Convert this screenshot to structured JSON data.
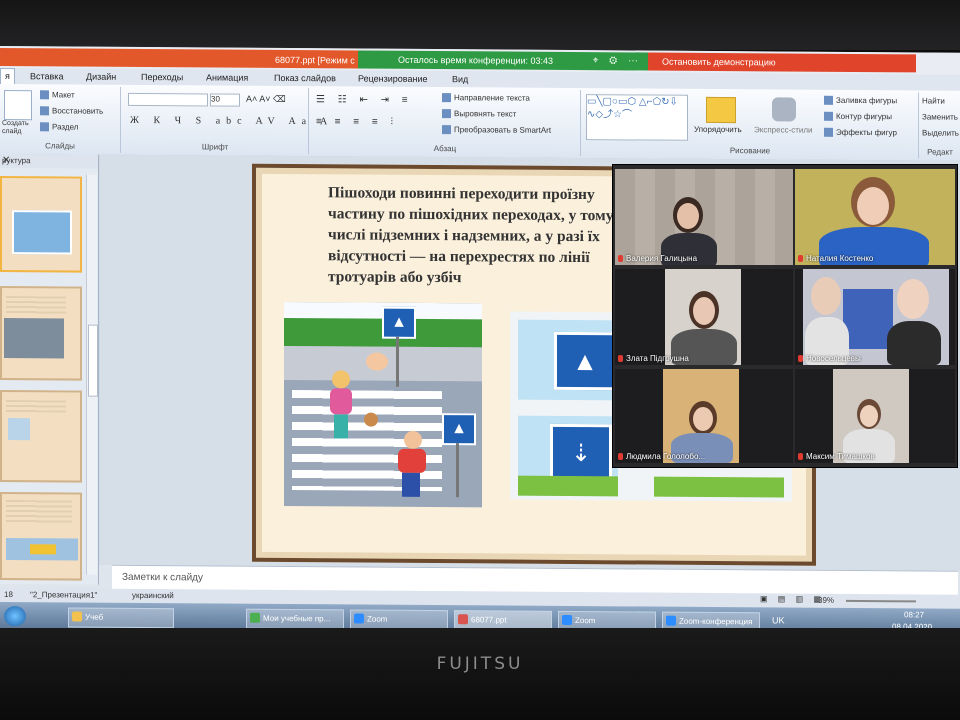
{
  "window": {
    "title": "68077.ppt [Режим с",
    "conference_timer": "Осталось время конференции: 03:43",
    "stop_demo": "Остановить демонстрацию"
  },
  "tabs": [
    "Вставка",
    "Дизайн",
    "Переходы",
    "Анимация",
    "Показ слайдов",
    "Рецензирование",
    "Вид"
  ],
  "ribbon": {
    "slides_group": {
      "create": "Создать слайд",
      "layout": "Макет",
      "reset": "Восстановить",
      "section": "Раздел",
      "label": "Слайды"
    },
    "font_group": {
      "size": "30",
      "label": "Шрифт"
    },
    "paragraph_group": {
      "text_direction": "Направление текста",
      "align_text": "Выровнять текст",
      "smartart": "Преобразовать в SmartArt",
      "label": "Абзац"
    },
    "drawing_group": {
      "arrange": "Упорядочить",
      "quick_styles": "Экспресс-стили",
      "fill": "Заливка фигуры",
      "outline": "Контур фигуры",
      "effects": "Эффекты фигур",
      "label": "Рисование"
    },
    "editing_group": {
      "find": "Найти",
      "replace": "Заменить",
      "select": "Выделить",
      "label": "Редакт"
    }
  },
  "panel": {
    "title": "руктура"
  },
  "slide": {
    "text": "Пішоходи повинні переходити проїзну частину по пішохідних переходах, у тому числі підземних і надземних, а у разі їх відсутності — на перехрестях по лінії тротуарів або узбіч"
  },
  "notes": "Заметки к слайду",
  "statusbar": {
    "slide_no": "18",
    "theme": "\"2_Презентация1\"",
    "language": "украинский",
    "zoom": "39%"
  },
  "taskbar": [
    {
      "label": "Учеб",
      "color": "#f2c14e"
    },
    {
      "label": "Мои учебные пр...",
      "color": "#4caf50"
    },
    {
      "label": "Zoom",
      "color": "#2d8cff"
    },
    {
      "label": "68077.ppt",
      "color": "#d9534f"
    },
    {
      "label": "Zoom",
      "color": "#2d8cff"
    },
    {
      "label": "Zoom-конференция",
      "color": "#2d8cff"
    }
  ],
  "tray": {
    "lang": "UK",
    "time": "08:27",
    "date": "08.04.2020"
  },
  "participants": [
    {
      "name": "Валерия Галицына"
    },
    {
      "name": "Наталия Костенко"
    },
    {
      "name": "Злата Підгрушна"
    },
    {
      "name": "Новосельцевы"
    },
    {
      "name": "Людмила Гололобо..."
    },
    {
      "name": "Максим Тимашков"
    }
  ],
  "brand": "FUJITSU",
  "colors": {
    "ppt_orange": "#e3582a",
    "zoom_green": "#2e9b44",
    "stop_red": "#e0442a",
    "slide_border": "#6b4a2e",
    "sign_blue": "#1f5fb4"
  }
}
